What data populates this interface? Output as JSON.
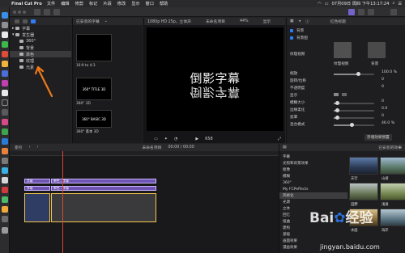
{
  "menubar": {
    "app_name": "Final Cut Pro",
    "items": [
      "文件",
      "编辑",
      "修剪",
      "标记",
      "片段",
      "修改",
      "显示",
      "窗口",
      "帮助"
    ],
    "clock": "07月09日 周四 下午13:17:24"
  },
  "toolbar": {
    "browser_filter": "已安装的字幕",
    "viewer_format": "1080p HD 25p，立体声",
    "viewer_project": "未命名项目",
    "zoom": "44%",
    "view_label": "显示",
    "inspector_title": "红色标题"
  },
  "sidebar": {
    "items": [
      {
        "label": "字幕",
        "level": 0
      },
      {
        "label": "发生器",
        "level": 0
      },
      {
        "label": "360°",
        "level": 1
      },
      {
        "label": "背景",
        "level": 1
      },
      {
        "label": "单色",
        "level": 1
      },
      {
        "label": "纹理",
        "level": 1
      },
      {
        "label": "元素",
        "level": 1
      }
    ],
    "selected_index": 4
  },
  "browser": {
    "thumbs": [
      {
        "caption": "16:9 to 4:3",
        "inner": ""
      },
      {
        "caption": "360° 3D",
        "inner": "360° TITLE 3D"
      },
      {
        "caption": "360° 基本 3D",
        "inner": "360° BASIC 3D"
      }
    ]
  },
  "viewer": {
    "title_text": "倒影字幕",
    "timecode": "658"
  },
  "inspector": {
    "sections": [
      "背景",
      "背景图"
    ],
    "thumb_labels": [
      "纹理视频",
      "背景"
    ],
    "params": [
      {
        "label": "缩放",
        "value": "100.0 %"
      },
      {
        "label": "旋转/位移",
        "value": "0"
      },
      {
        "label": "不透明度",
        "value": "0"
      },
      {
        "label": "显示",
        "value": ""
      },
      {
        "label": "模糊大小",
        "value": "0"
      },
      {
        "label": "边缘柔化",
        "value": "0.0"
      },
      {
        "label": "遮罩",
        "value": "0"
      },
      {
        "label": "混合模式",
        "value": "46.0 %"
      }
    ],
    "save_button": "存储效果预置"
  },
  "timeline": {
    "index_label": "索引",
    "project_name": "未命名项目",
    "duration": "00:00 / 00:00",
    "clip_label": "字幕",
    "clip_label2": "单色 - 字幕"
  },
  "effects": {
    "title": "已安装的效果",
    "categories": [
      "字幕",
      "光照和背景效果",
      "抠像",
      "模糊",
      "360°",
      "My FCPeffects",
      "风格化",
      "光源",
      "立体",
      "回忆",
      "扭曲",
      "建构",
      "基础",
      "画面效果",
      "漫画效果"
    ],
    "selected_category": 6,
    "thumbs": [
      "天空",
      "山坡",
      "田野",
      "浅滩",
      "水面",
      "海岸"
    ]
  },
  "watermark": {
    "brand": "Bai",
    "brand_suffix": "经验",
    "url": "jingyan.baidu.com"
  }
}
